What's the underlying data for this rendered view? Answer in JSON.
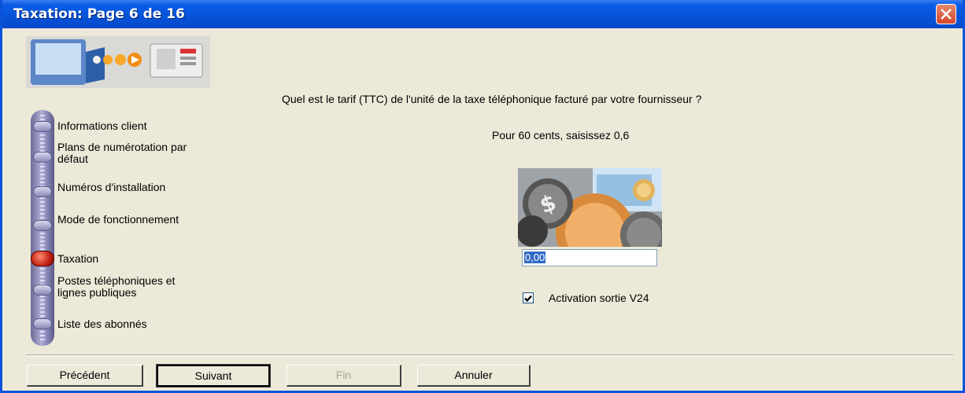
{
  "window": {
    "title": "Taxation:  Page 6 de 16"
  },
  "main": {
    "question": "Quel est le tarif (TTC) de l'unité de la taxe téléphonique facturé par votre fournisseur ?",
    "hint": "Pour 60 cents, saisissez 0,6",
    "tariff_value": "0,00",
    "checkbox_label": "Activation sortie V24",
    "checkbox_checked": true
  },
  "steps": [
    {
      "label": "Informations client"
    },
    {
      "label": "Plans de numérotation par défaut"
    },
    {
      "label": "Numéros d'installation"
    },
    {
      "label": "Mode de fonctionnement"
    },
    {
      "label": "Taxation",
      "active": true
    },
    {
      "label": "Postes téléphoniques et lignes publiques"
    },
    {
      "label": "Liste des abonnés"
    }
  ],
  "buttons": {
    "previous": "Précédent",
    "next": "Suivant",
    "finish": "Fin",
    "cancel": "Annuler"
  },
  "icons": {
    "close": "close-icon",
    "check": "check-icon"
  },
  "colors": {
    "titlebar": "#0553d9",
    "window_bg": "#ece9d8",
    "active_step": "#c02010"
  }
}
